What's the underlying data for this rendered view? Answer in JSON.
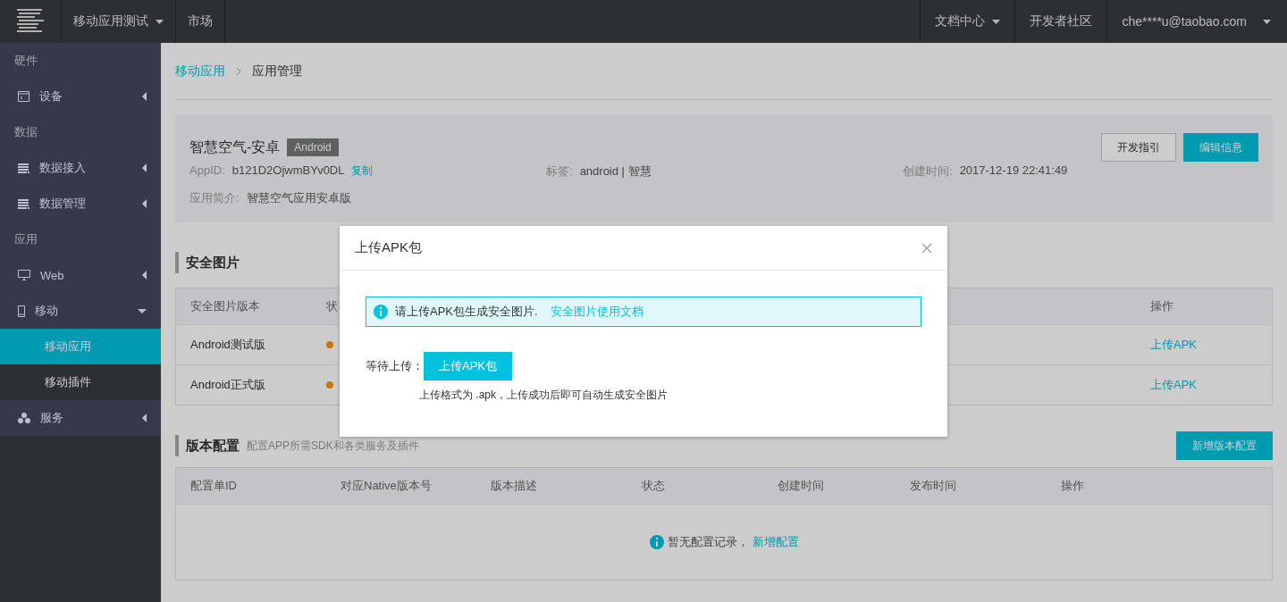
{
  "topbar": {
    "nav": [
      {
        "label": "移动应用测试",
        "dropdown": true
      },
      {
        "label": "市场",
        "dropdown": false
      }
    ],
    "right": [
      {
        "label": "文档中心",
        "dropdown": true
      },
      {
        "label": "开发者社区",
        "dropdown": false
      },
      {
        "label": "che****u@taobao.com",
        "dropdown": true
      }
    ]
  },
  "sidebar": {
    "groups": [
      {
        "title": "硬件",
        "items": [
          {
            "label": "设备",
            "expanded": false
          }
        ]
      },
      {
        "title": "数据",
        "items": [
          {
            "label": "数据接入",
            "expanded": false
          },
          {
            "label": "数据管理",
            "expanded": false
          }
        ]
      },
      {
        "title": "应用",
        "items": [
          {
            "label": "Web",
            "expanded": false
          },
          {
            "label": "移动",
            "expanded": true,
            "children": [
              {
                "label": "移动应用",
                "selected": true
              },
              {
                "label": "移动插件",
                "selected": false
              }
            ]
          },
          {
            "label": "服务",
            "expanded": false
          }
        ]
      }
    ]
  },
  "breadcrumb": [
    {
      "label": "移动应用",
      "link": true
    },
    {
      "label": "应用管理",
      "link": false
    }
  ],
  "app": {
    "name": "智慧空气-安卓",
    "badge": "Android",
    "buttons": [
      {
        "label": "开发指引",
        "kind": "default"
      },
      {
        "label": "编辑信息",
        "kind": "primary"
      }
    ],
    "fields": [
      {
        "label": "AppID:",
        "value": "b121D2OjwmBYv0DL",
        "action": "复制"
      },
      {
        "label": "标签:",
        "value": "android | 智慧"
      },
      {
        "label": "创建时间:",
        "value": "2017-12-19 22:41:49"
      },
      {
        "label": "应用简介:",
        "value": "智慧空气应用安卓版"
      }
    ]
  },
  "security": {
    "title": "安全图片",
    "columns": [
      "安全图片版本",
      "状",
      "操作"
    ],
    "rows": [
      {
        "version": "Android测试版",
        "action": "上传APK"
      },
      {
        "version": "Android正式版",
        "action": "上传APK"
      }
    ]
  },
  "versions": {
    "title": "版本配置",
    "subtitle": "配置APP所需SDK和各类服务及插件",
    "button": "新增版本配置",
    "columns": [
      "配置单ID",
      "对应Native版本号",
      "版本描述",
      "状态",
      "创建时间",
      "发布时间",
      "操作"
    ],
    "empty": {
      "text": "暂无配置记录，",
      "link": "新增配置"
    }
  },
  "modal": {
    "title": "上传APK包",
    "notice": {
      "text": "请上传APK包生成安全图片.",
      "link": "安全图片使用文档"
    },
    "field_label": "等待上传：",
    "button": "上传APK包",
    "hint": "上传格式为 .apk，上传成功后即可自动生成安全图片"
  }
}
